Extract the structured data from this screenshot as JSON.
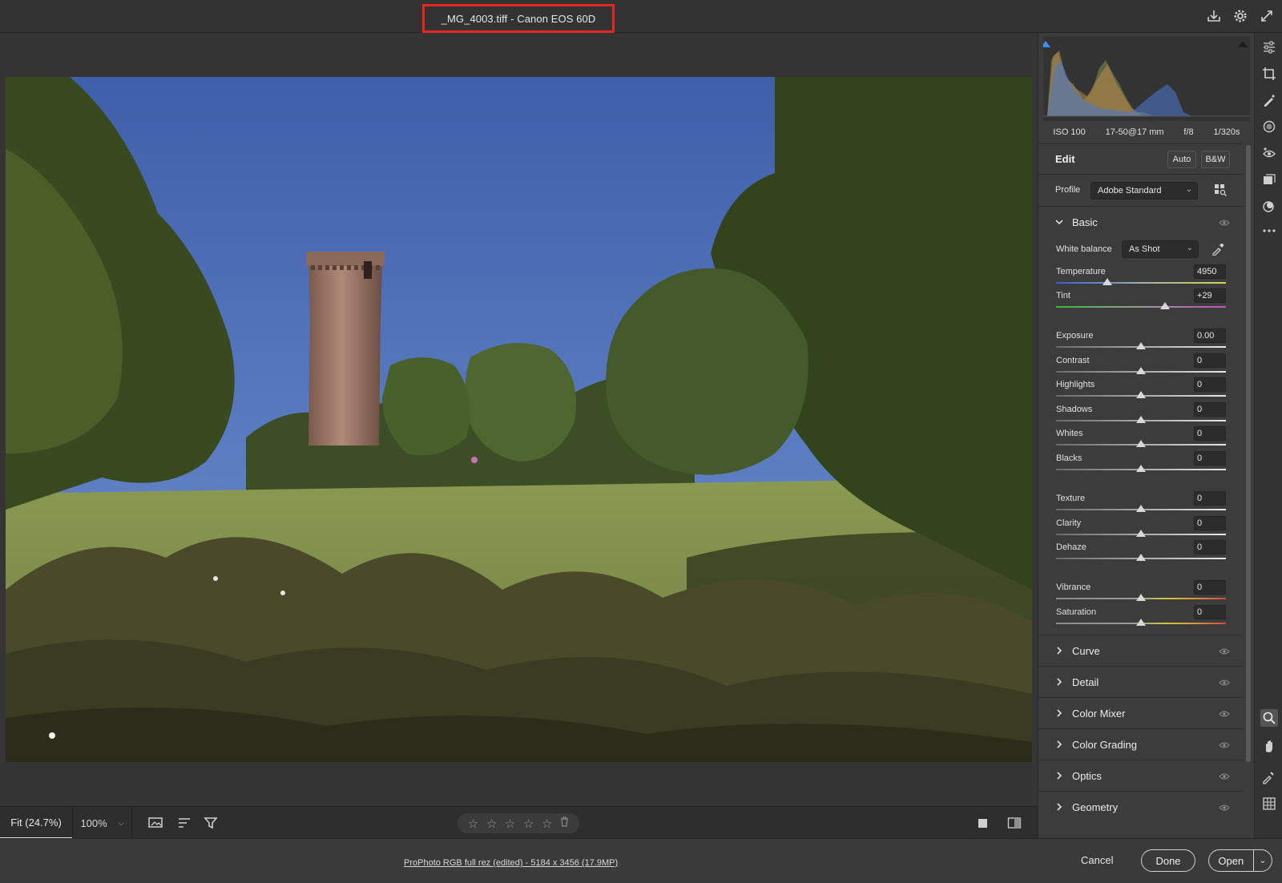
{
  "window": {
    "title": "_MG_4003.tiff  -  Canon EOS 60D"
  },
  "photo": {
    "subject": "Stone tower in a meadow with trees under a blue sky"
  },
  "histogram": {
    "clip_colors": {
      "shadow": "#3f8cff",
      "highlight": "#222222"
    }
  },
  "exif": {
    "iso": "ISO 100",
    "lens": "17-50@17 mm",
    "aperture": "f/8",
    "shutter": "1/320s"
  },
  "edit": {
    "title": "Edit",
    "auto_label": "Auto",
    "bw_label": "B&W",
    "profile_label": "Profile",
    "profile_value": "Adobe Standard"
  },
  "basic": {
    "title": "Basic",
    "white_balance_label": "White balance",
    "white_balance_value": "As Shot",
    "sliders": [
      {
        "name": "Temperature",
        "value": "4950",
        "pos": 0.3
      },
      {
        "name": "Tint",
        "value": "+29",
        "pos": 0.64
      },
      {
        "name": "Exposure",
        "value": "0.00",
        "pos": 0.5
      },
      {
        "name": "Contrast",
        "value": "0",
        "pos": 0.5
      },
      {
        "name": "Highlights",
        "value": "0",
        "pos": 0.5
      },
      {
        "name": "Shadows",
        "value": "0",
        "pos": 0.5
      },
      {
        "name": "Whites",
        "value": "0",
        "pos": 0.5
      },
      {
        "name": "Blacks",
        "value": "0",
        "pos": 0.5
      },
      {
        "name": "Texture",
        "value": "0",
        "pos": 0.5
      },
      {
        "name": "Clarity",
        "value": "0",
        "pos": 0.5
      },
      {
        "name": "Dehaze",
        "value": "0",
        "pos": 0.5
      },
      {
        "name": "Vibrance",
        "value": "0",
        "pos": 0.5
      },
      {
        "name": "Saturation",
        "value": "0",
        "pos": 0.5
      }
    ]
  },
  "sections": [
    {
      "label": "Curve"
    },
    {
      "label": "Detail"
    },
    {
      "label": "Color Mixer"
    },
    {
      "label": "Color Grading"
    },
    {
      "label": "Optics"
    },
    {
      "label": "Geometry"
    }
  ],
  "bottombar": {
    "zoom_fit": "Fit (24.7%)",
    "zoom_100": "100%",
    "stars": [
      "☆",
      "☆",
      "☆",
      "☆",
      "☆"
    ]
  },
  "footer": {
    "info_link": "ProPhoto RGB full rez (edited) - 5184 x 3456 (17.9MP)",
    "cancel": "Cancel",
    "done": "Done",
    "open": "Open"
  }
}
